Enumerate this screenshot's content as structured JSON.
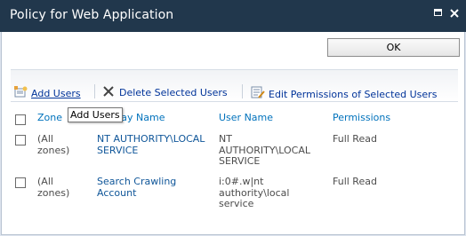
{
  "window": {
    "title": "Policy for Web Application"
  },
  "actions": {
    "ok_label": "OK"
  },
  "toolbar": {
    "add_users": "Add Users",
    "delete_users": "Delete Selected Users",
    "edit_permissions": "Edit Permissions of Selected Users"
  },
  "tooltip": "Add Users",
  "table": {
    "headers": {
      "zone": "Zone",
      "display_name": "Display Name",
      "user_name": "User Name",
      "permissions": "Permissions"
    },
    "rows": [
      {
        "zone": [
          "(All",
          "zones)"
        ],
        "display_name": [
          "NT AUTHORITY\\LOCAL",
          "SERVICE"
        ],
        "user_name": [
          "NT",
          "AUTHORITY\\LOCAL",
          "SERVICE"
        ],
        "permissions": "Full Read"
      },
      {
        "zone": [
          "(All",
          "zones)"
        ],
        "display_name": [
          "Search Crawling",
          "Account"
        ],
        "user_name": [
          "i:0#.w|nt",
          "authority\\local",
          "service"
        ],
        "permissions": "Full Read"
      }
    ]
  },
  "icons": {
    "add_users": "add-users-icon",
    "delete": "x-delete-icon",
    "edit_permissions": "edit-permissions-icon",
    "maximize": "maximize-icon",
    "close": "close-icon"
  },
  "colors": {
    "titlebar": "#21374c",
    "link": "#0f5699",
    "header": "#0072bc"
  }
}
